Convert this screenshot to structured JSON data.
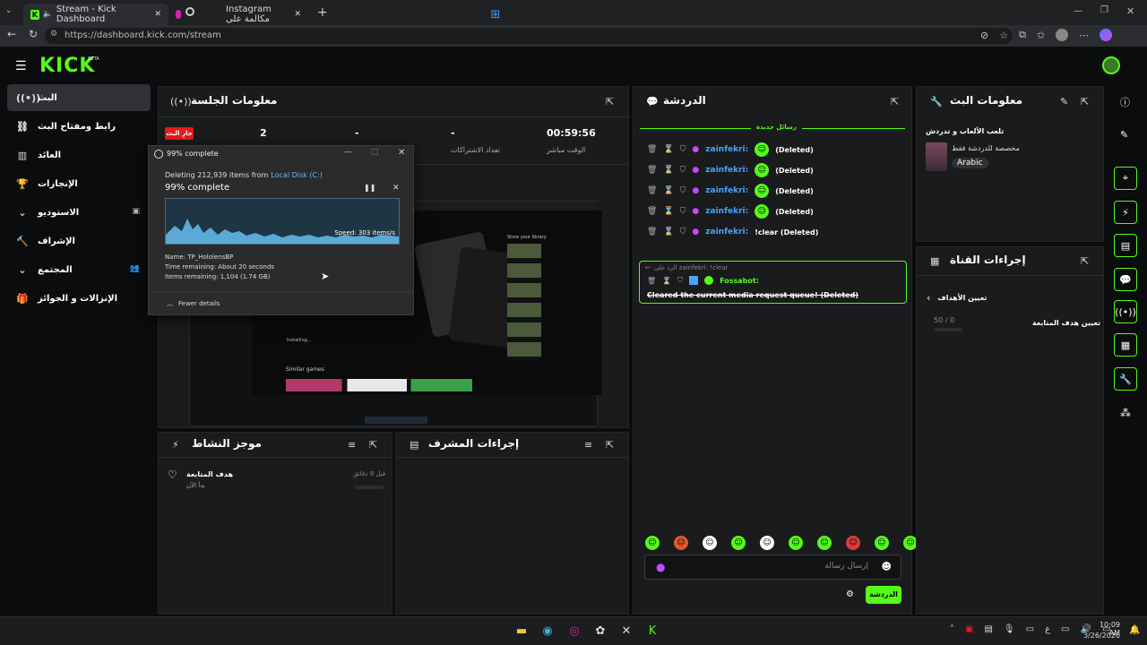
{
  "browser": {
    "tabs": [
      {
        "label": "Stream - Kick Dashboard",
        "icon": "kick-icon"
      },
      {
        "label": "",
        "icon": "instagram-icon"
      },
      {
        "label": "Instagram مكالمة على",
        "icon": "circle-icon"
      }
    ],
    "url": "https://dashboard.kick.com/stream"
  },
  "header": {
    "logo": "KICK",
    "beta": "BETA"
  },
  "sidebar": {
    "items": [
      {
        "label": "البث",
        "icon": "broadcast-icon"
      },
      {
        "label": "رابط ومفتاح البث",
        "icon": "link-icon"
      },
      {
        "label": "العائد",
        "icon": "chart-icon"
      },
      {
        "label": "الإنجازات",
        "icon": "trophy-icon"
      },
      {
        "label": "الاستوديو",
        "icon": "studio-icon"
      },
      {
        "label": "الإشراف",
        "icon": "hammer-icon"
      },
      {
        "label": "المجتمع",
        "icon": "community-icon"
      },
      {
        "label": "الإنزالات و الجوائز",
        "icon": "gift-icon"
      }
    ]
  },
  "session": {
    "title": "معلومات الجلسة",
    "live_badge": "جارِ البث",
    "viewers": "2",
    "followers": "-",
    "subs": "-",
    "subs_label": "تعداد الاشتراكات",
    "duration": "00:59:56",
    "duration_label": "الوقت مباشر"
  },
  "file_dialog": {
    "title": "99% complete",
    "deleting_text": "Deleting 212,939 items from",
    "location": "Local Disk (C:)",
    "progress_text": "99% complete",
    "progress_value": 0.99,
    "speed": "Speed: 303 items/s",
    "name": "Name: TP_HololensBP",
    "time_remaining": "Time remaining: About 20 seconds",
    "items_remaining": "Items remaining: 1,104 (1.74 GB)",
    "fewer_details": "Fewer details"
  },
  "preview": {
    "store_title": "Store your library",
    "similar_games": "Similar games",
    "installing": "Installing..."
  },
  "activity": {
    "title": "موجز النشاط",
    "item_title": "هدف المتابعة",
    "item_sub": "بدأ الآن",
    "item_time": "قبل 9 دقائق"
  },
  "mod_actions": {
    "title": "إجراءات المشرف"
  },
  "chat": {
    "title": "الدردشة",
    "new_messages": "رسائل جديدة",
    "messages": [
      {
        "user": "zainfekri:",
        "text": "(Deleted)"
      },
      {
        "user": "zainfekri:",
        "text": "(Deleted)"
      },
      {
        "user": "zainfekri:",
        "text": "(Deleted)"
      },
      {
        "user": "zainfekri:",
        "text": "(Deleted)"
      },
      {
        "user": "zainfekri:",
        "text": "!clear (Deleted)"
      }
    ],
    "reply_to": "الرد على zainfekri: !clear",
    "bot_user": "Fossabot:",
    "bot_text": "Cleared the current media request queue! (Deleted)",
    "input_placeholder": "إرسال رسالة",
    "send_label": "الدردشة"
  },
  "stream_info": {
    "title": "معلومات البث",
    "subtitle": "تلعب الألعاب و تدردش",
    "tag1": "مخصصة للدردشة فقط",
    "language": "Arabic"
  },
  "channel_actions": {
    "title": "إجراءات القناة",
    "goals_label": "تعيين الأهداف",
    "goal_count": "50 / 0",
    "goal_name": "تعيين هدف المتابعة"
  },
  "taskbar": {
    "time": "10:09 AM",
    "date": "3/26/2026",
    "lang": "ع"
  },
  "colors": {
    "accent": "#53fc18",
    "panel": "#191b1c",
    "bg": "#0b0c0d"
  }
}
